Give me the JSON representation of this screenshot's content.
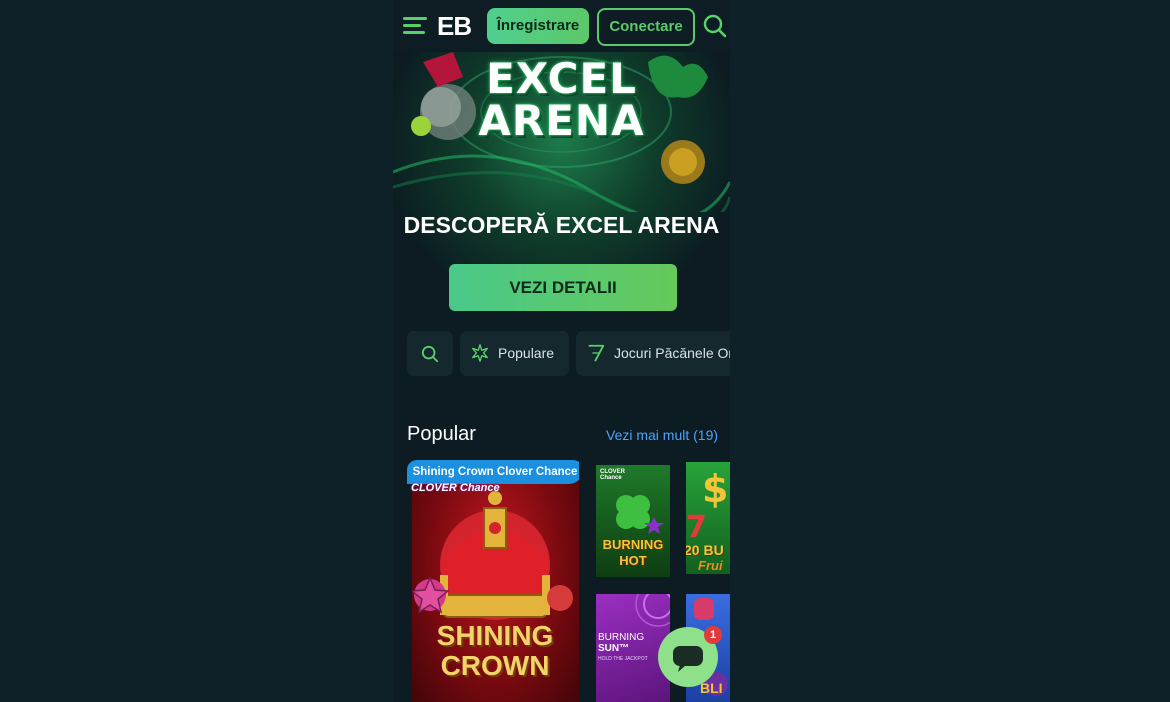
{
  "header": {
    "logo": "EB",
    "register_label": "Înregistrare",
    "login_label": "Conectare"
  },
  "hero": {
    "logo_line1": "EXCEL",
    "logo_line2": "ARENA",
    "title": "DESCOPERĂ EXCEL ARENA",
    "button_label": "VEZI DETALII"
  },
  "categories": [
    {
      "label": "",
      "icon": "search-icon"
    },
    {
      "label": "Populare",
      "icon": "sparkle-icon"
    },
    {
      "label": "Jocuri Păcănele Online",
      "icon": "seven-icon"
    }
  ],
  "popular": {
    "title": "Popular",
    "more_label": "Vezi mai mult (19)",
    "featured": {
      "tag": "Shining Crown Clover Chance",
      "badge": "CLOVER Chance",
      "name_line1": "SHINING",
      "name_line2": "CROWN"
    },
    "games": [
      {
        "name_line1": "BURNING",
        "name_line2": "HOT",
        "badge": "CLOVER Chance"
      },
      {
        "name_line1": "20 BU",
        "name_line2": "Frui"
      },
      {
        "name_line1": "BURNING",
        "name_line2": "SUN™",
        "subtitle": "HOLD THE JACKPOT"
      },
      {
        "name_line1": "",
        "name_line2": "BLI"
      }
    ]
  },
  "chat": {
    "badge_count": "1"
  },
  "colors": {
    "accent_green": "#5cc86a",
    "link_blue": "#4da3ff",
    "background": "#0c1c22"
  }
}
